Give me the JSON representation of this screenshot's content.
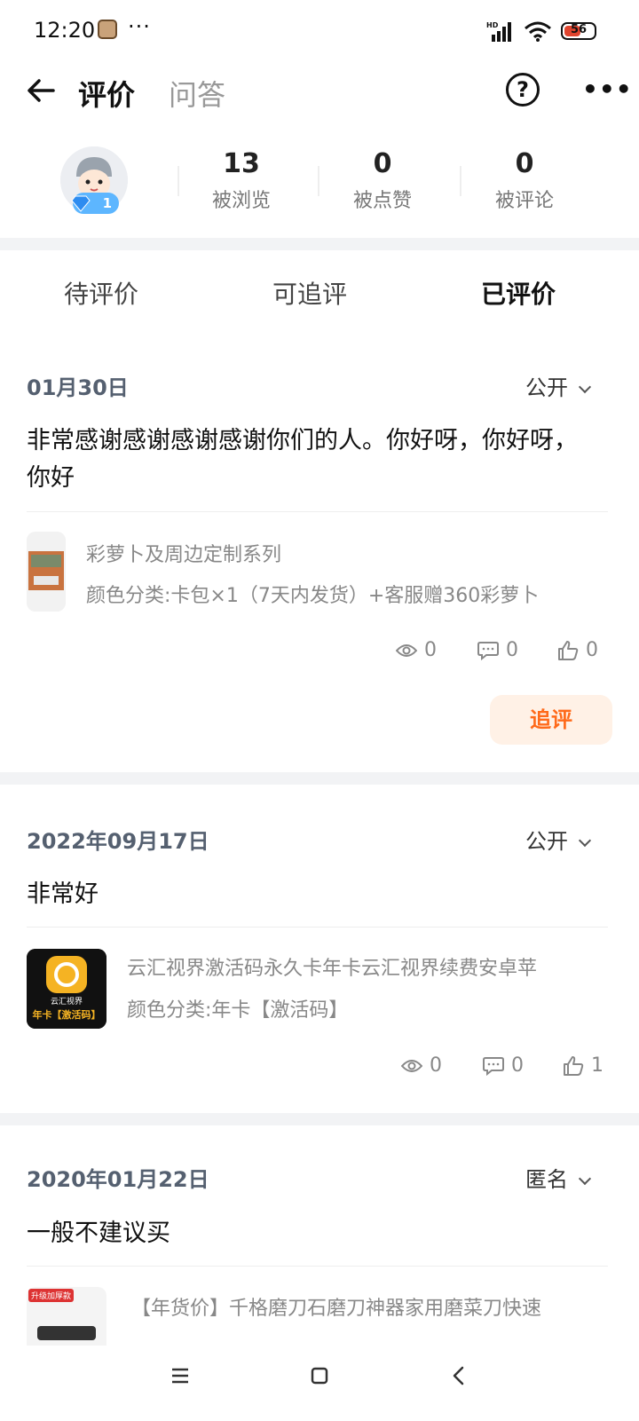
{
  "status_bar": {
    "time": "12:20",
    "dots": "···",
    "battery": "56",
    "battery_level": 0.56
  },
  "nav": {
    "title": "评价",
    "tab2": "问答"
  },
  "profile": {
    "level": "1",
    "stats": [
      {
        "value": "13",
        "label": "被浏览"
      },
      {
        "value": "0",
        "label": "被点赞"
      },
      {
        "value": "0",
        "label": "被评论"
      }
    ]
  },
  "tabs": [
    "待评价",
    "可追评",
    "已评价"
  ],
  "reviews": [
    {
      "date": "01月30日",
      "visibility": "公开",
      "text": "非常感谢感谢感谢感谢你们的人。你好呀，你好呀，你好",
      "product_title": "彩萝卜及周边定制系列",
      "product_spec": "颜色分类:卡包×1（7天内发货）+客服赠360彩萝卜",
      "views": "0",
      "comments": "0",
      "likes": "0",
      "followup_label": "追评"
    },
    {
      "date": "2022年09月17日",
      "visibility": "公开",
      "text": "非常好",
      "product_title": "云汇视界激活码永久卡年卡云汇视界续费安卓苹",
      "product_spec": "颜色分类:年卡【激活码】",
      "thumb_text_top": "云汇视界",
      "thumb_text_bottom": "年卡【激活码】",
      "views": "0",
      "comments": "0",
      "likes": "1"
    },
    {
      "date": "2020年01月22日",
      "visibility": "匿名",
      "text": "一般不建议买",
      "product_title": "【年货价】千格磨刀石磨刀神器家用磨菜刀快速",
      "thumb_text_top": "升级加厚款"
    }
  ],
  "colors": {
    "accent": "#ff6a1a",
    "accent_bg": "#fff1e6",
    "date": "#556070"
  }
}
